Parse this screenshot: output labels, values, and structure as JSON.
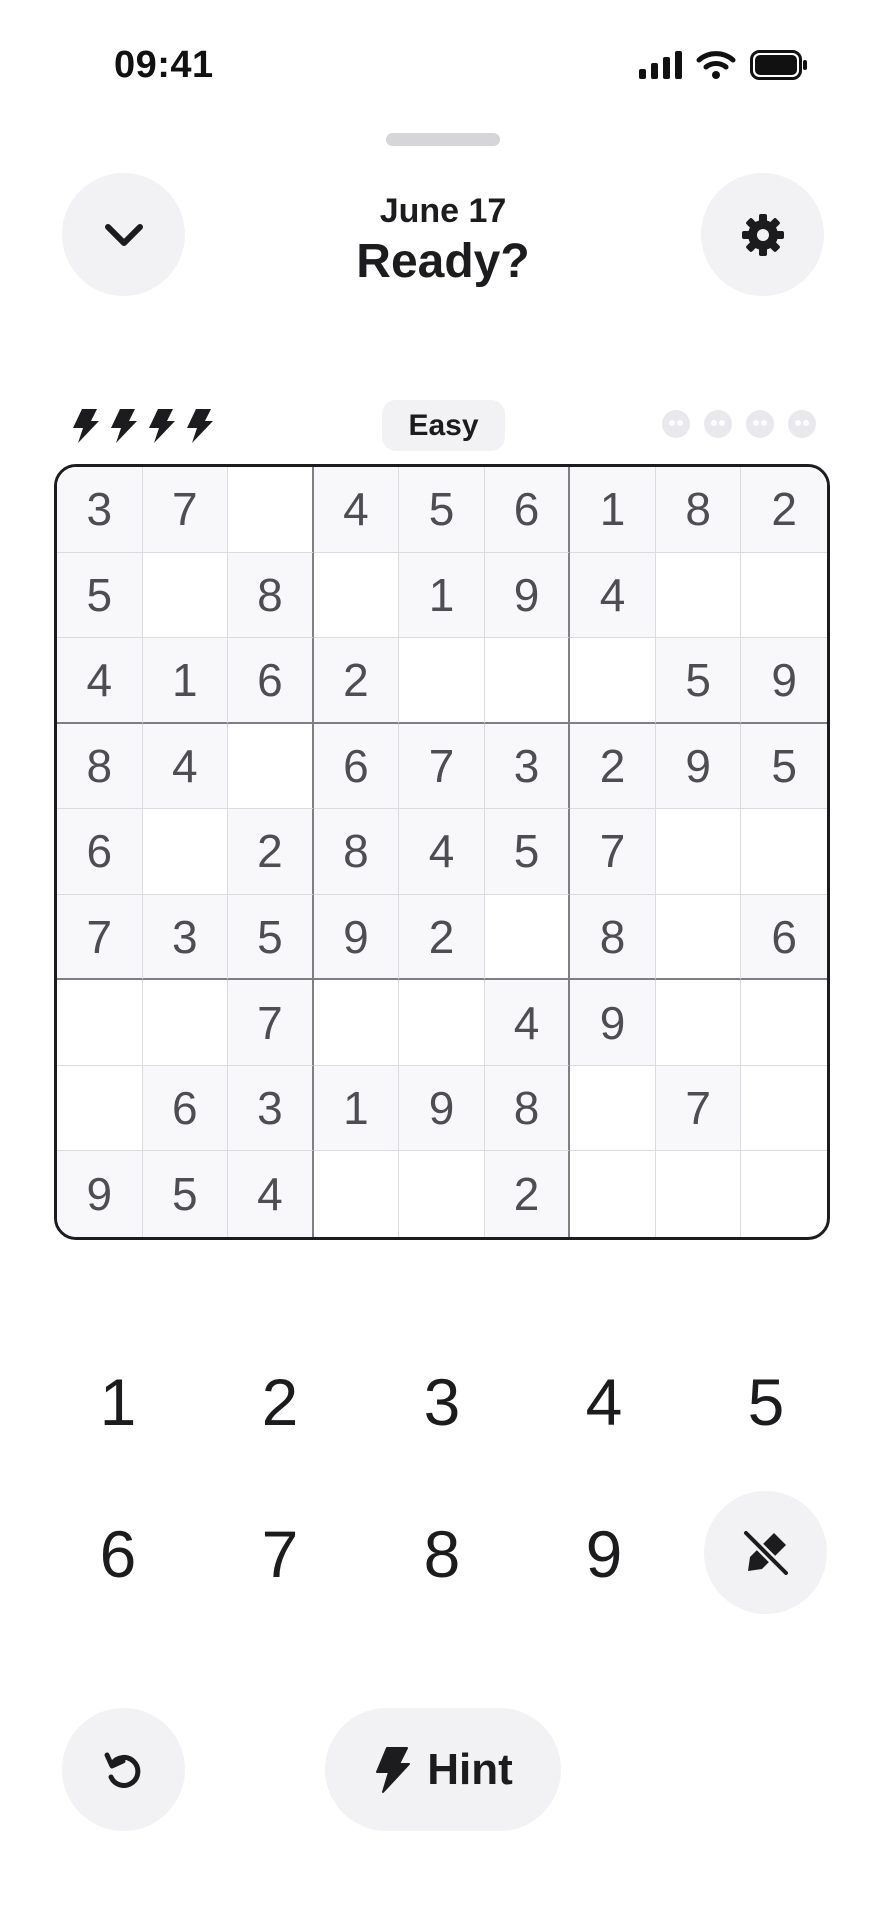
{
  "status_bar": {
    "time": "09:41"
  },
  "header": {
    "date": "June 17",
    "title": "Ready?",
    "collapse_icon": "chevron-down-icon",
    "settings_icon": "gear-icon"
  },
  "info": {
    "hints_remaining": 4,
    "hint_icon": "lightning-icon",
    "difficulty": "Easy",
    "mistakes_allowed": 4,
    "mistakes_made": 0,
    "mistake_icon": "skull-icon"
  },
  "board": {
    "rows": [
      [
        "3",
        "7",
        "",
        "4",
        "5",
        "6",
        "1",
        "8",
        "2"
      ],
      [
        "5",
        "",
        "8",
        "",
        "1",
        "9",
        "4",
        "",
        ""
      ],
      [
        "4",
        "1",
        "6",
        "2",
        "",
        "",
        "",
        "5",
        "9"
      ],
      [
        "8",
        "4",
        "",
        "6",
        "7",
        "3",
        "2",
        "9",
        "5"
      ],
      [
        "6",
        "",
        "2",
        "8",
        "4",
        "5",
        "7",
        "",
        ""
      ],
      [
        "7",
        "3",
        "5",
        "9",
        "2",
        "",
        "8",
        "",
        "6"
      ],
      [
        "",
        "",
        "7",
        "",
        "",
        "4",
        "9",
        "",
        ""
      ],
      [
        "",
        "6",
        "3",
        "1",
        "9",
        "8",
        "",
        "7",
        ""
      ],
      [
        "9",
        "5",
        "4",
        "",
        "",
        "2",
        "",
        "",
        ""
      ]
    ]
  },
  "keypad": {
    "keys": [
      "1",
      "2",
      "3",
      "4",
      "5",
      "6",
      "7",
      "8",
      "9"
    ],
    "notes_icon": "pencil-off-icon"
  },
  "toolbar": {
    "undo_icon": "undo-icon",
    "hint_label": "Hint",
    "hint_icon": "lightning-icon"
  },
  "colors": {
    "text": "#1c1c1e",
    "digit": "#4e4e52",
    "button_bg": "#f2f1f3",
    "board_border": "#1c1c1e"
  }
}
